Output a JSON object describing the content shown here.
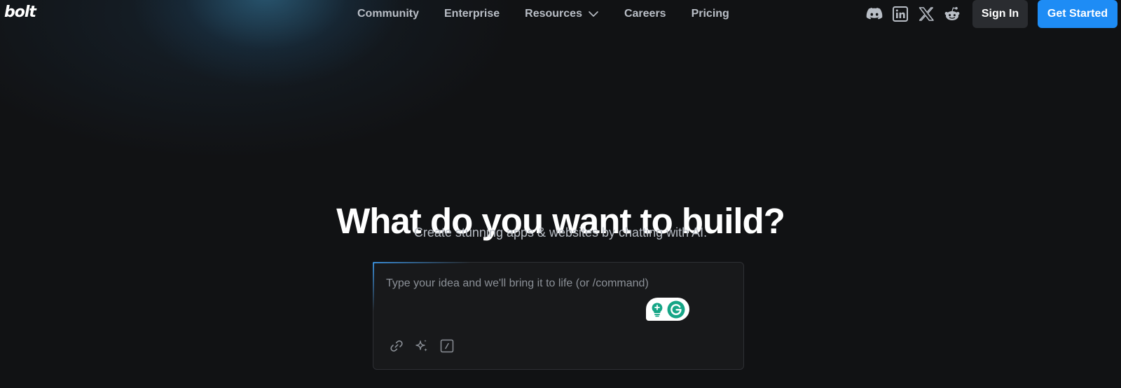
{
  "header": {
    "logo_text": "bolt",
    "nav": [
      {
        "label": "Community"
      },
      {
        "label": "Enterprise"
      },
      {
        "label": "Resources"
      },
      {
        "label": "Careers"
      },
      {
        "label": "Pricing"
      }
    ],
    "socials": [
      "discord-icon",
      "linkedin-icon",
      "x-icon",
      "reddit-icon"
    ],
    "sign_in_label": "Sign In",
    "get_started_label": "Get Started"
  },
  "hero": {
    "title": "What do you want to build?",
    "subtitle": "Create stunning apps & websites by chatting with AI."
  },
  "prompt": {
    "placeholder": "Type your idea and we'll bring it to life (or /command)",
    "value": "",
    "tools": [
      "link-icon",
      "sparkle-icon",
      "slash-command-icon"
    ],
    "grammarly_icons": [
      "grammarly-suggestion-icon",
      "grammarly-logo-icon"
    ]
  },
  "colors": {
    "background": "#111214",
    "accent": "#1e8cf5",
    "nav_text": "#b9bec6",
    "grammarly_green": "#15a586"
  }
}
